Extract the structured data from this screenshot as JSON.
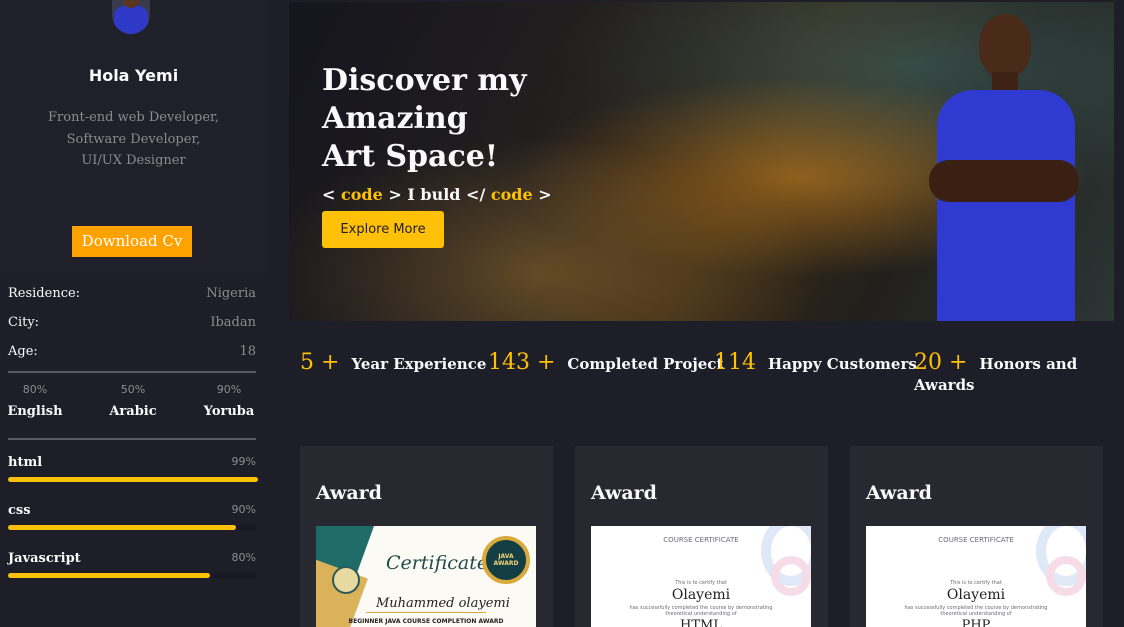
{
  "sidebar": {
    "profile": {
      "name": "Hola Yemi",
      "roles": [
        "Front-end web Developer,",
        "Software Developer,",
        "UI/UX Designer"
      ],
      "cv_button": "Download Cv"
    },
    "info": [
      {
        "label": "Residence:",
        "value": "Nigeria"
      },
      {
        "label": "City:",
        "value": "Ibadan"
      },
      {
        "label": "Age:",
        "value": "18"
      }
    ],
    "languages": [
      {
        "percent": "80%",
        "name": "English"
      },
      {
        "percent": "50%",
        "name": "Arabic"
      },
      {
        "percent": "90%",
        "name": "Yoruba"
      }
    ],
    "skills": [
      {
        "name": "html",
        "percent": "99%",
        "level": 99
      },
      {
        "name": "css",
        "percent": "90%",
        "level": 90
      },
      {
        "name": "Javascript",
        "percent": "80%",
        "level": 80
      }
    ]
  },
  "hero": {
    "title_line1": "Discover my Amazing",
    "title_line2": "Art Space!",
    "code_open": "<",
    "code_word1": "code",
    "code_mid": "> I buld </",
    "code_word2": "code",
    "code_close": ">",
    "button": "Explore More"
  },
  "stats": [
    {
      "number": "5 +",
      "label": "Year Experience"
    },
    {
      "number": "143 +",
      "label": "Completed Project"
    },
    {
      "number": "114",
      "label": "Happy Customers"
    },
    {
      "number": "20 +",
      "label": "Honors and Awards"
    }
  ],
  "awards": [
    {
      "title": "Award",
      "cert": {
        "heading": "Certificate",
        "seal": "JAVA AWARD",
        "name": "Muhammed olayemi",
        "footer": "BEGINNER JAVA COURSE COMPLETION AWARD"
      }
    },
    {
      "title": "Award",
      "cert": {
        "heading": "COURSE CERTIFICATE",
        "intro": "This is to certify that",
        "name": "Olayemi",
        "desc": "has successfully completed the course by demonstrating theoretical understanding of",
        "course": "HTML"
      }
    },
    {
      "title": "Award",
      "cert": {
        "heading": "COURSE CERTIFICATE",
        "intro": "This is to certify that",
        "name": "Olayemi",
        "desc": "has successfully completed the course by demonstrating theoretical understanding of",
        "course": "PHP"
      }
    }
  ],
  "colors": {
    "accent": "#ffc107",
    "cv_button": "#ffa200",
    "background": "#1e1e28",
    "panel": "#282830"
  }
}
